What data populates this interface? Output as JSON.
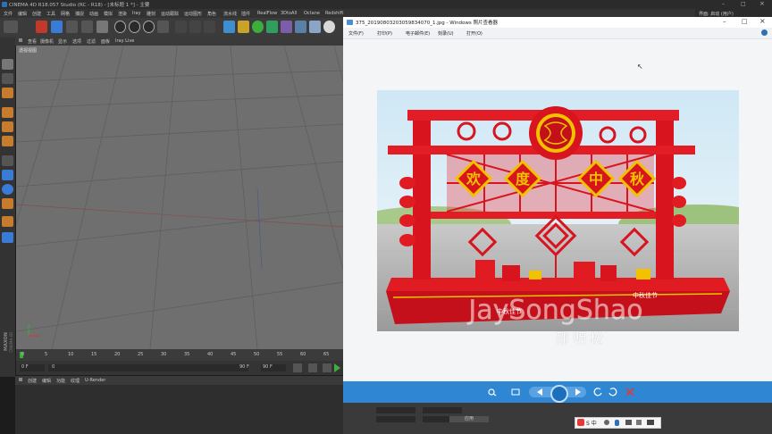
{
  "c4d": {
    "title": "CINEMA 4D R18.057 Studio (RC - R18) - [未标题 1 *] - 主要",
    "menus": [
      "文件",
      "编辑",
      "创建",
      "工具",
      "网格",
      "捕捉",
      "动画",
      "模拟",
      "渲染",
      "Iray",
      "雕刻",
      "运动跟踪",
      "运动图形",
      "角色",
      "流水线",
      "插件",
      "RealFlow",
      "3DtoAll",
      "Octane",
      "Redshift",
      "脚本",
      "窗口",
      "帮助"
    ],
    "right_header": "界面: 启动 (用户)",
    "viewport_menu": [
      "查看",
      "摄像机",
      "显示",
      "选项",
      "过滤",
      "面板",
      "Iray Live"
    ],
    "viewport_label": "透视视图",
    "timeline_ticks": [
      "0",
      "5",
      "10",
      "15",
      "20",
      "25",
      "30",
      "35",
      "40",
      "45",
      "50",
      "55",
      "60",
      "65"
    ],
    "frame_start": "0 F",
    "frame_mid": "0",
    "frame_end_a": "90 F",
    "frame_end_b": "90 F",
    "material_menu": [
      "创建",
      "编辑",
      "功能",
      "纹理",
      "U-Render"
    ],
    "attr_button": "应用",
    "side_logo_1": "MAXON",
    "side_logo_2": "CINEMA 4D"
  },
  "viewer": {
    "title": "375_20190803203059834070_1.jpg - Windows 照片查看器",
    "menus": [
      "文件(F)",
      "打印(P)",
      "电子邮件(E)",
      "刻录(U)",
      "打开(O)"
    ],
    "image_text": {
      "chars": [
        "欢",
        "度",
        "中",
        "秋"
      ],
      "watermark": "JaySongShao",
      "watermark2": "邵明松",
      "base_left": "中秋佳节",
      "base_right": "中秋佳节"
    },
    "colors": {
      "accent": "#2f87d3",
      "red": "#d8141e",
      "gold": "#f2c200"
    }
  },
  "ime": {
    "label": "S 中"
  }
}
